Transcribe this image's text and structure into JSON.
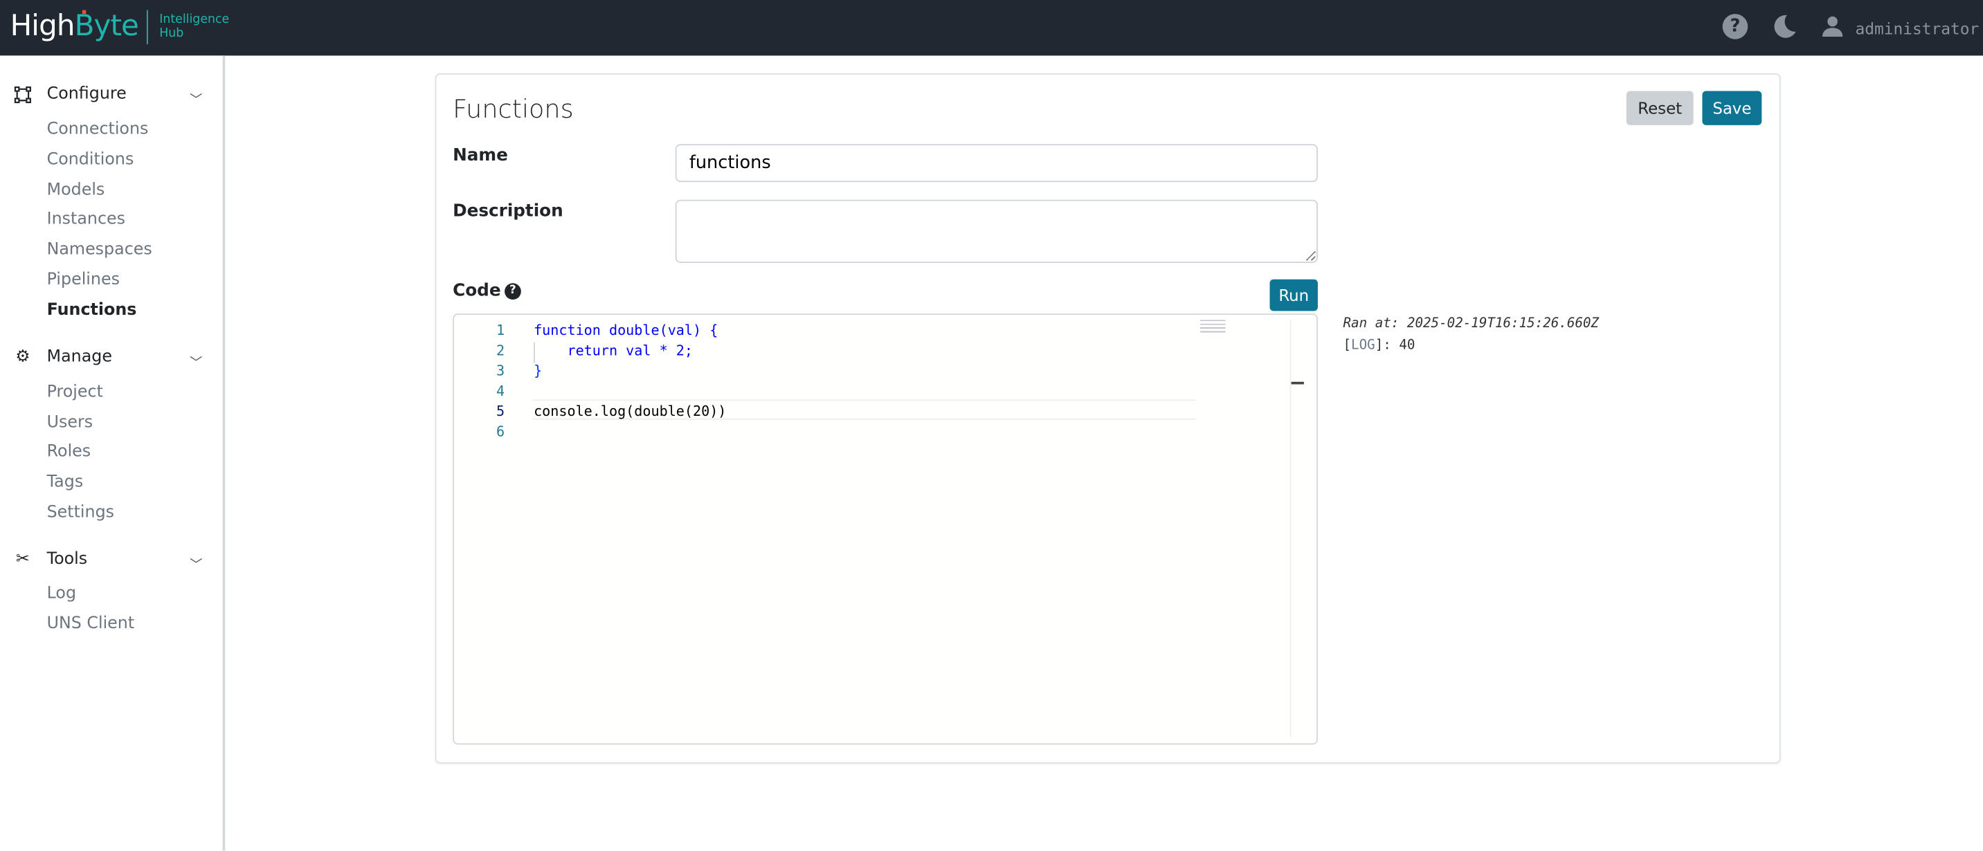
{
  "header": {
    "logo_high": "High",
    "logo_byte": "Byte",
    "logo_sub_1": "Intelligence",
    "logo_sub_2": "Hub",
    "help_icon": "question-circle-icon",
    "theme_icon": "moon-icon",
    "user_icon": "user-icon",
    "username": "administrator"
  },
  "sidebar": {
    "sections": [
      {
        "label": "Configure",
        "icon": "nodes-icon",
        "items": [
          "Connections",
          "Conditions",
          "Models",
          "Instances",
          "Namespaces",
          "Pipelines",
          "Functions"
        ]
      },
      {
        "label": "Manage",
        "icon": "gear-icon",
        "items": [
          "Project",
          "Users",
          "Roles",
          "Tags",
          "Settings"
        ]
      },
      {
        "label": "Tools",
        "icon": "tools-icon",
        "items": [
          "Log",
          "UNS Client"
        ]
      }
    ],
    "active_item": "Functions"
  },
  "main": {
    "title": "Functions",
    "reset_label": "Reset",
    "save_label": "Save",
    "name_label": "Name",
    "name_value": "functions",
    "description_label": "Description",
    "description_value": "",
    "code_label": "Code",
    "run_label": "Run",
    "code_lines": [
      "function double(val) {",
      "    return val * 2;",
      "}",
      "",
      "console.log(double(20))",
      ""
    ],
    "line_numbers": [
      "1",
      "2",
      "3",
      "4",
      "5",
      "6"
    ],
    "output": {
      "ran_at": "Ran at: 2025-02-19T16:15:26.660Z",
      "log_open": "[",
      "log_tag": "LOG",
      "log_rest": "]: 40"
    }
  },
  "colors": {
    "header_bg": "#222831",
    "brand_teal": "#1fb5ac",
    "primary_button": "#0f7595",
    "reset_button": "#ccd1d6"
  }
}
